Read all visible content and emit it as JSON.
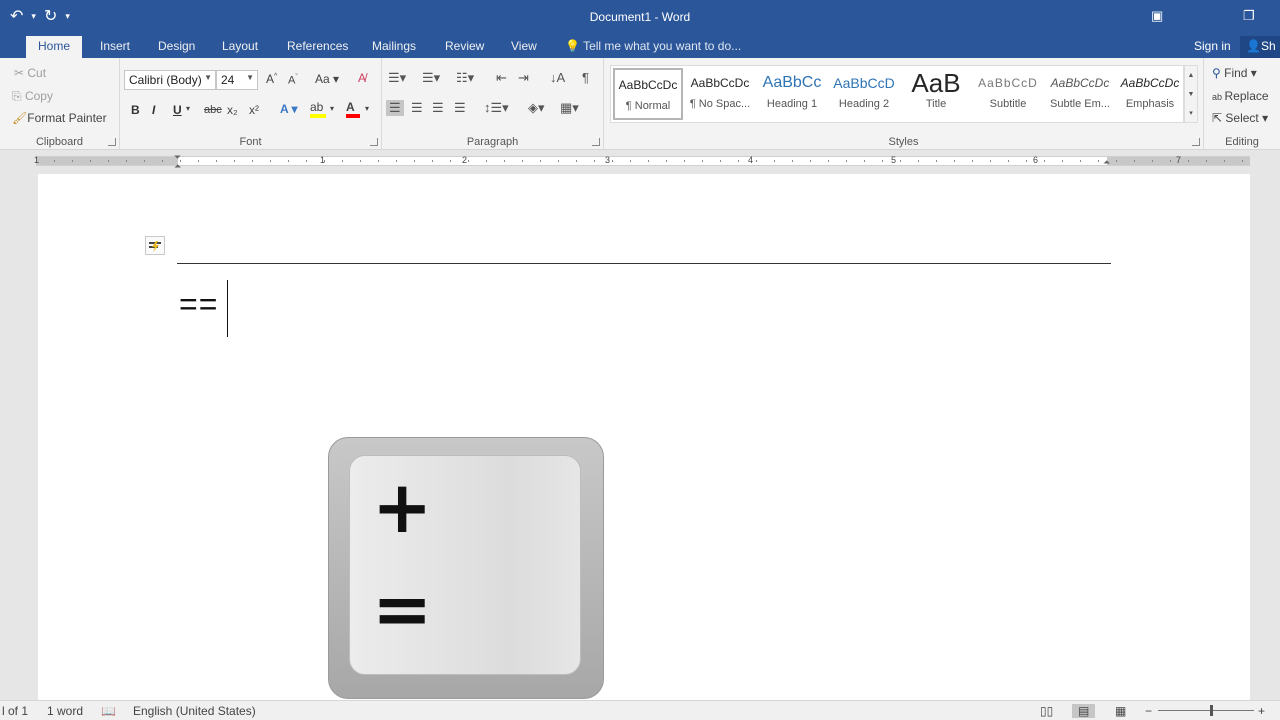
{
  "window": {
    "title": "Document1 - Word"
  },
  "qat": {
    "undo_icon": "undo-icon",
    "redo_icon": "redo-icon"
  },
  "tabs": [
    {
      "label": "Home",
      "active": true
    },
    {
      "label": "Insert"
    },
    {
      "label": "Design"
    },
    {
      "label": "Layout"
    },
    {
      "label": "References"
    },
    {
      "label": "Mailings"
    },
    {
      "label": "Review"
    },
    {
      "label": "View"
    }
  ],
  "tellme": "Tell me what you want to do...",
  "account": {
    "signin": "Sign in",
    "share": "Sh"
  },
  "clipboard": {
    "cut": "Cut",
    "copy": "Copy",
    "format_painter": "Format Painter",
    "label": "Clipboard"
  },
  "font": {
    "name": "Calibri (Body)",
    "size": "24",
    "change_case": "Aa",
    "bold": "B",
    "italic": "I",
    "underline": "U",
    "strike": "abc",
    "subscript": "x₂",
    "superscript": "x²",
    "label": "Font"
  },
  "paragraph": {
    "label": "Paragraph",
    "show_marks": "¶"
  },
  "styles": {
    "label": "Styles",
    "items": [
      {
        "sample": "AaBbCcDc",
        "name": "¶ Normal"
      },
      {
        "sample": "AaBbCcDc",
        "name": "¶ No Spac..."
      },
      {
        "sample": "AaBbCc",
        "name": "Heading 1"
      },
      {
        "sample": "AaBbCcD",
        "name": "Heading 2"
      },
      {
        "sample": "AaB",
        "name": "Title"
      },
      {
        "sample": "AaBbCcD",
        "name": "Subtitle"
      },
      {
        "sample": "AaBbCcDc",
        "name": "Subtle Em..."
      },
      {
        "sample": "AaBbCcDc",
        "name": "Emphasis"
      }
    ]
  },
  "editing": {
    "find": "Find",
    "replace": "Replace",
    "select": "Select",
    "label": "Editing"
  },
  "ruler": {
    "numbers": [
      "1",
      "1",
      "2",
      "3",
      "4",
      "5",
      "6",
      "7"
    ]
  },
  "document": {
    "text": "=="
  },
  "keycap": {
    "top_symbol": "+",
    "bottom_symbol": "="
  },
  "status": {
    "page": "l of 1",
    "words": "1 word",
    "language": "English (United States)"
  },
  "colors": {
    "brand": "#2b579a",
    "ribbon": "#f3f3f3",
    "highlight": "#ffff00",
    "font_color": "#ff0000"
  }
}
